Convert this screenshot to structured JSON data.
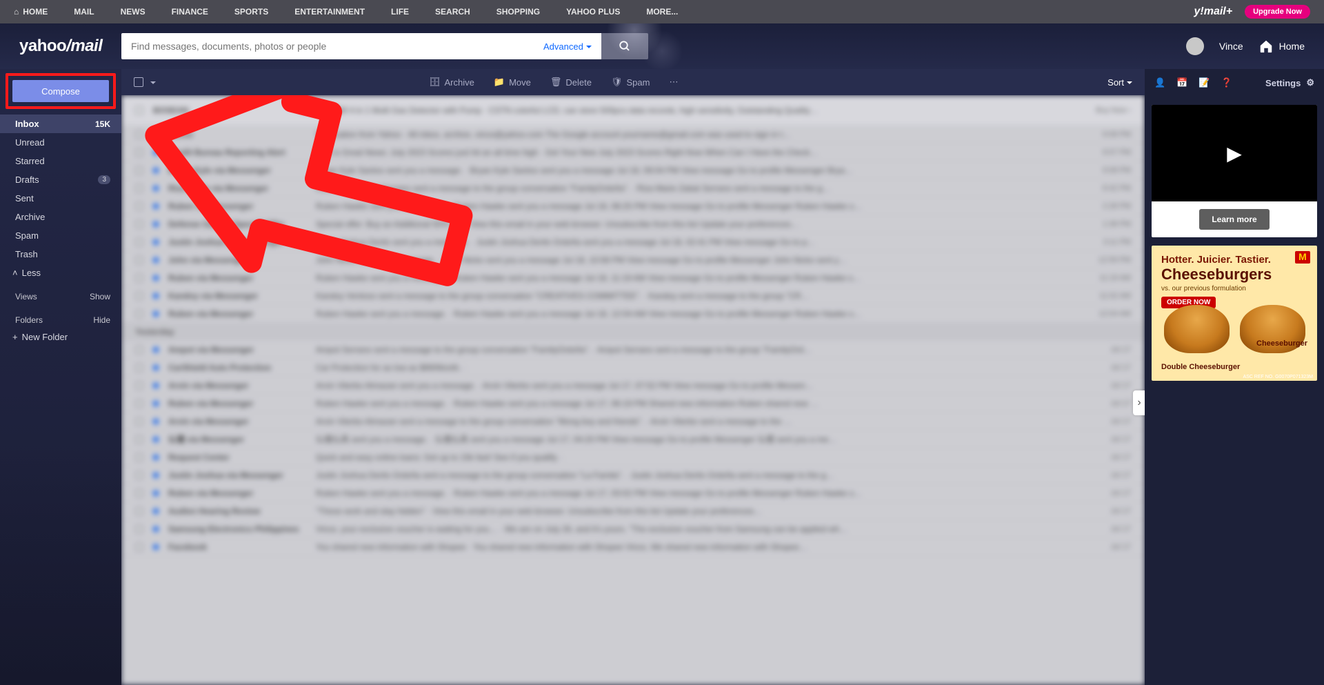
{
  "topnav": {
    "items": [
      "HOME",
      "MAIL",
      "NEWS",
      "FINANCE",
      "SPORTS",
      "ENTERTAINMENT",
      "LIFE",
      "SEARCH",
      "SHOPPING",
      "YAHOO PLUS",
      "MORE..."
    ],
    "brand": "y!mail+",
    "upgrade": "Upgrade Now"
  },
  "header": {
    "logo_a": "yahoo",
    "logo_b": "/mail",
    "search_placeholder": "Find messages, documents, photos or people",
    "advanced": "Advanced",
    "user_name": "Vince",
    "home": "Home"
  },
  "sidebar": {
    "compose": "Compose",
    "folders": [
      {
        "label": "Inbox",
        "count": "15K",
        "active": true
      },
      {
        "label": "Unread"
      },
      {
        "label": "Starred"
      },
      {
        "label": "Drafts",
        "badge": "3"
      },
      {
        "label": "Sent"
      },
      {
        "label": "Archive"
      },
      {
        "label": "Spam"
      },
      {
        "label": "Trash"
      }
    ],
    "less": "Less",
    "views_label": "Views",
    "views_action": "Show",
    "folders_label": "Folders",
    "folders_action": "Hide",
    "new_folder": "New Folder"
  },
  "toolbar": {
    "archive": "Archive",
    "move": "Move",
    "delete": "Delete",
    "spam": "Spam",
    "sort": "Sort"
  },
  "rail": {
    "settings": "Settings",
    "learn_more": "Learn more",
    "ad": {
      "line1": "Hotter. Juicier. Tastier.",
      "line2": "Cheeseburgers",
      "line3": "vs. our previous formulation",
      "order": "ORDER NOW",
      "cap_left": "Double Cheeseburger",
      "cap_right": "Cheeseburger",
      "logo": "M",
      "ref": "ASC REF NO. G0070P071323M"
    }
  },
  "list": {
    "section_yesterday": "Yesterday",
    "rows": [
      {
        "ad": true,
        "from": "BOSEAN",
        "subj": "Ad · S-600M 4 in 1 Multi Gas Detector with Pump · CSTN colorful LCD, can store 500pcs data records, high sensitivity, Outstanding Quality…",
        "time": "Buy Now ›"
      },
      {
        "from": "Yahoo",
        "subj": "Notification from Yahoo · All inbox, archive, vince@yahoo.com The Google account yourname@gmail.com was used to sign in t…",
        "time": "9:08 PM"
      },
      {
        "from": "Credit Bureau Reporting Alert",
        "subj": "This is Great News: July 2023 Scores just hit an all time high · Get Your New July 2023 Scores Right Now When Can I Have the Check…",
        "time": "9:07 PM"
      },
      {
        "from": "Bryan Kyle via Messenger",
        "subj": "Bryan Kyle Santos sent you a message. · Bryan Kyle Santos sent you a message Jul 18, 09:04 PM View message Go to profile Messenger Brya…",
        "time": "9:08 PM"
      },
      {
        "from": "Riza Marie via Messenger",
        "subj": "Riza Marie Zabat Serrano sent a message to the group conversation \"FamilyOrdoña\". · Riza Marie Zabat Serrano sent a message to the g…",
        "time": "8:42 PM"
      },
      {
        "from": "Ruben via Messenger",
        "subj": "Ruben Hawke sent you a message. · Ruben Hawke sent you a message Jul 18, 08:25 PM View message Go to profile Messenger Ruben Hawke s…",
        "time": "2:28 PM"
      },
      {
        "from": "Defense Gadget Special Offer",
        "subj": "Special offer: Buy an Additional 50% Off · View this email in your web browser. Unsubscribe from this list Update your preferences…",
        "time": "1:38 PM"
      },
      {
        "from": "Justin Joshua via Messenger",
        "subj": "Justin Joshua Derilo sent you a message. · Justin Joshua Derilo Ordoña sent you a message Jul 18, 02:41 PM View message Go to p…",
        "time": "3:11 PM"
      },
      {
        "from": "John via Messenger",
        "subj": "John Nicko sent you a message. · John Nicko sent you a message Jul 18, 10:58 PM View message Go to profile Messenger John Nicko sent y…",
        "time": "12:59 PM"
      },
      {
        "from": "Ruben via Messenger",
        "subj": "Ruben Hawke sent you a message. · Ruben Hawke sent you a message Jul 18, 11:19 AM View message Go to profile Messenger Ruben Hawke s…",
        "time": "11:19 AM"
      },
      {
        "from": "Kandoy via Messenger",
        "subj": "Kandoy Ventoso sent a message to the group conversation \"CREATIVES COMMITTEE\". · Kandoy sent a message to the group \"CR…",
        "time": "11:02 AM"
      },
      {
        "from": "Ruben via Messenger",
        "subj": "Ruben Hawke sent you a message. · Ruben Hawke sent you a message Jul 18, 12:04 AM View message Go to profile Messenger Ruben Hawke s…",
        "time": "12:04 AM"
      }
    ],
    "rows2": [
      {
        "from": "Ampot via Messenger",
        "subj": "Ampot Serrano sent a message to the group conversation \"FamilyOrdoña\". · Ampot Serrano sent a message to the group \"FamilyOrd…",
        "time": "Jul 17"
      },
      {
        "from": "CarShield Auto Protection",
        "subj": "Car Protection for as low as $99/Month. ·",
        "time": "Jul 17"
      },
      {
        "from": "Arvin via Messenger",
        "subj": "Arvin Viterbo Almazan sent you a message. · Arvin Viterbo sent you a message Jul 17, 07:52 PM View message Go to profile Messen…",
        "time": "Jul 17"
      },
      {
        "from": "Ruben via Messenger",
        "subj": "Ruben Hawke sent you a message. · Ruben Hawke sent you a message Jul 17, 06:19 PM Shared new information Ruben shared new …",
        "time": "Jul 17"
      },
      {
        "from": "Arvin via Messenger",
        "subj": "Arvin Viterbo Almazan sent a message to the group conversation \"Mong boy and friends\". · Arvin Viterbo sent a message to the …",
        "time": "Jul 17"
      },
      {
        "from": "仏壇 via Messenger",
        "subj": "仏壇仏具 sent you a message. · 仏壇仏具 sent you a message Jul 17, 04:20 PM View message Go to profile Messenger 仏壇 sent you a me…",
        "time": "Jul 17"
      },
      {
        "from": "Request Center",
        "subj": "Quick and easy online loans: Get up to 15k fast! See if you qualify. ·",
        "time": "Jul 17"
      },
      {
        "from": "Justin Joshua via Messenger",
        "subj": "Justin Joshua Derilo Ordoña sent a message to the group conversation \"La Famila\". · Justin Joshua Derilo Ordoña sent a message to the g…",
        "time": "Jul 17"
      },
      {
        "from": "Ruben via Messenger",
        "subj": "Ruben Hawke sent you a message. · Ruben Hawke sent you a message Jul 17, 03:02 PM View message Go to profile Messenger Ruben Hawke s…",
        "time": "Jul 17"
      },
      {
        "from": "Audien Hearing Review",
        "subj": "\"These work and stay hidden\" · View this email in your web browser. Unsubscribe from this list Update your preferences…",
        "time": "Jul 17"
      },
      {
        "from": "Samsung Electronics Philippines",
        "subj": "Vince, your exclusive voucher is waiting for you… · We are on July 26, and it's yours. \"The exclusive voucher from Samsung can be applied wh…",
        "time": "Jul 17"
      },
      {
        "from": "Facebook",
        "subj": "You shared new information with Shopee · You shared new information with Shopee Vince, We shared new information with Shopee…",
        "time": "Jul 17"
      }
    ]
  }
}
